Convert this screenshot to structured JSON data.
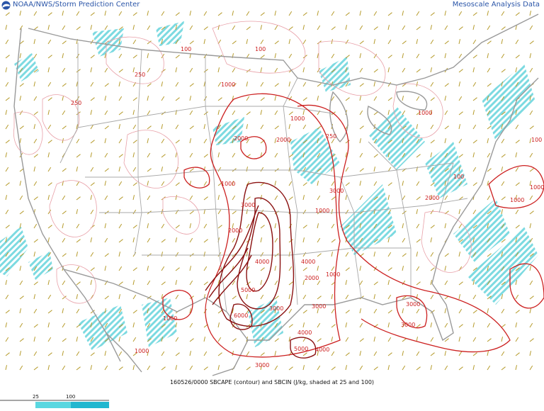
{
  "header": {
    "agency": "NOAA/NWS/Storm Prediction Center",
    "product": "Mesoscale Analysis Data"
  },
  "caption": "160526/0000 SBCAPE (contour) and SBCIN (J/kg, shaded at 25 and 100)",
  "legend": {
    "ticks": [
      "25",
      "100"
    ],
    "colors": [
      "#5ad7e0",
      "#22b7cf"
    ]
  },
  "colors": {
    "border": "#9a9a9a",
    "cape_contour": "#cc2020",
    "cape_strong": "#8a1010",
    "cape_thin": "#e8a0a8",
    "cin_shade": "#6ed6de",
    "wind_barb": "#b59a2a",
    "header_text": "#2a55a8"
  },
  "contour_labels": [
    {
      "text": "1000"
    },
    {
      "text": "1000"
    },
    {
      "text": "1000"
    },
    {
      "text": "1000"
    },
    {
      "text": "2000"
    },
    {
      "text": "2000"
    },
    {
      "text": "3000"
    },
    {
      "text": "4000"
    },
    {
      "text": "5000"
    },
    {
      "text": "6000"
    },
    {
      "text": "5000"
    },
    {
      "text": "4000"
    },
    {
      "text": "3000"
    },
    {
      "text": "3000"
    },
    {
      "text": "4000"
    },
    {
      "text": "4000"
    },
    {
      "text": "3000"
    },
    {
      "text": "2000"
    },
    {
      "text": "1000"
    },
    {
      "text": "2000"
    },
    {
      "text": "3000"
    },
    {
      "text": "3000"
    },
    {
      "text": "1000"
    },
    {
      "text": "1000"
    },
    {
      "text": "250"
    },
    {
      "text": "250"
    },
    {
      "text": "100"
    },
    {
      "text": "100"
    },
    {
      "text": "250"
    },
    {
      "text": "100"
    },
    {
      "text": "1000"
    },
    {
      "text": "1000"
    },
    {
      "text": "3000"
    },
    {
      "text": "2000"
    },
    {
      "text": "1000"
    },
    {
      "text": "100"
    }
  ]
}
